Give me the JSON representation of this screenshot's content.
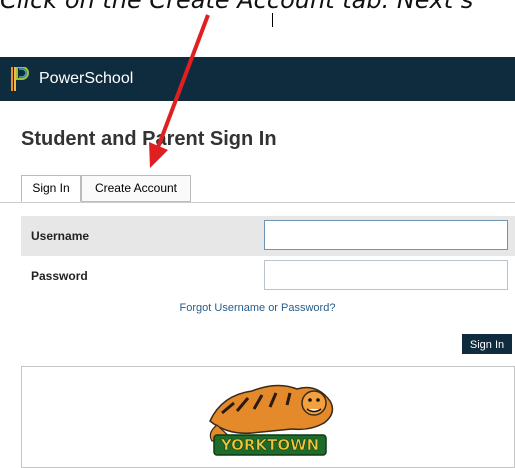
{
  "instruction": {
    "text": "Click on the Create Account tab. Next s"
  },
  "header": {
    "brand": "PowerSchool"
  },
  "page": {
    "title": "Student and Parent Sign In"
  },
  "tabs": [
    {
      "label": "Sign In"
    },
    {
      "label": "Create Account"
    }
  ],
  "form": {
    "username_label": "Username",
    "username_value": "",
    "password_label": "Password",
    "password_value": "",
    "forgot_link": "Forgot Username or Password?",
    "signin_button": "Sign In"
  },
  "logo": {
    "school_text": "YORKTOWN"
  },
  "colors": {
    "topbar": "#0e2c3e",
    "button": "#0e2c3e",
    "link": "#285d8a",
    "arrow": "#e02020"
  }
}
